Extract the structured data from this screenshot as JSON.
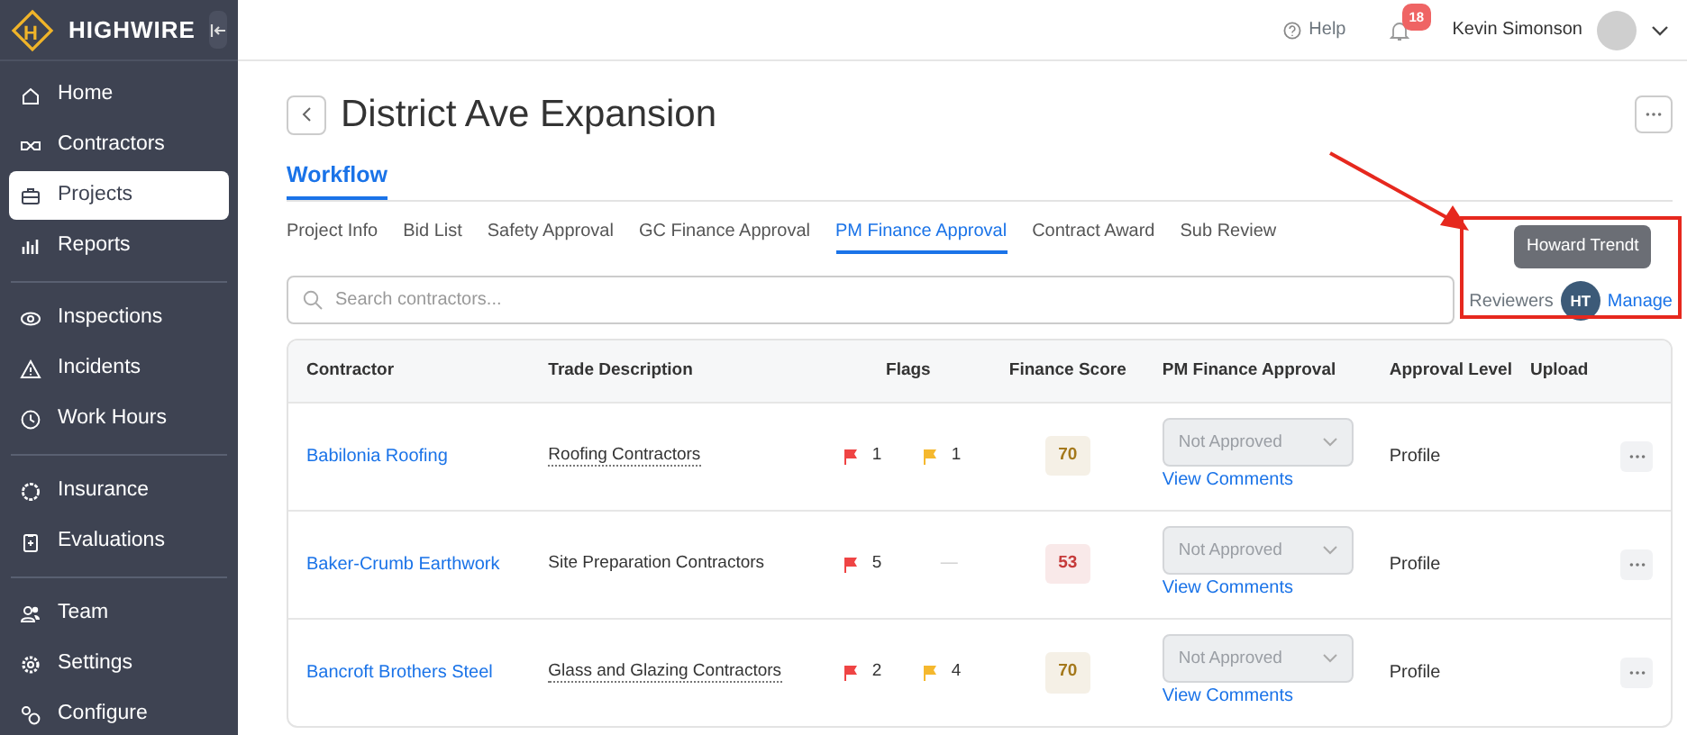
{
  "sidebar": {
    "logo_letter": "H",
    "brand": "HIGHWIRE",
    "groups": [
      [
        {
          "label": "Home",
          "selected": false
        },
        {
          "label": "Contractors",
          "selected": false
        },
        {
          "label": "Projects",
          "selected": true
        },
        {
          "label": "Reports",
          "selected": false
        }
      ],
      [
        {
          "label": "Inspections",
          "selected": false
        },
        {
          "label": "Incidents",
          "selected": false
        },
        {
          "label": "Work Hours",
          "selected": false
        }
      ],
      [
        {
          "label": "Insurance",
          "selected": false
        },
        {
          "label": "Evaluations",
          "selected": false
        }
      ],
      [
        {
          "label": "Team",
          "selected": false
        },
        {
          "label": "Settings",
          "selected": false
        },
        {
          "label": "Configure",
          "selected": false
        }
      ]
    ]
  },
  "topbar": {
    "help": "Help",
    "notifications": "18",
    "user": "Kevin Simonson"
  },
  "page": {
    "title": "District Ave Expansion",
    "section_tab": "Workflow",
    "tabs": [
      {
        "label": "Project Info",
        "selected": false
      },
      {
        "label": "Bid List",
        "selected": false
      },
      {
        "label": "Safety Approval",
        "selected": false
      },
      {
        "label": "GC Finance Approval",
        "selected": false
      },
      {
        "label": "PM Finance Approval",
        "selected": true
      },
      {
        "label": "Contract Award",
        "selected": false
      },
      {
        "label": "Sub Review",
        "selected": false
      }
    ],
    "search": {
      "placeholder": "Search contractors..."
    },
    "reviewers": {
      "label": "Reviewers",
      "initials": "HT",
      "tooltip": "Howard Trendt",
      "manage": "Manage"
    }
  },
  "table": {
    "columns": [
      "Contractor",
      "Trade Description",
      "Flags",
      "Finance Score",
      "PM Finance Approval",
      "Approval Level",
      "Upload"
    ],
    "rows": [
      {
        "contractor": "Babilonia Roofing",
        "trade": "Roofing Contractors",
        "dotted": true,
        "flags": [
          {
            "kind": "flag",
            "color": "#ef4444",
            "count": "1"
          },
          {
            "kind": "flag",
            "color": "#f5b82e",
            "count": "1"
          }
        ],
        "score": "70",
        "color": "#a4781b",
        "approval": "Not Approved",
        "comments": "View Comments",
        "level": "Profile"
      },
      {
        "contractor": "Baker-Crumb Earthwork",
        "trade": "Site Preparation Contractors",
        "dotted": false,
        "flags": [
          {
            "kind": "flag",
            "color": "#ef4444",
            "count": "5"
          },
          {
            "kind": "empty",
            "count": "—"
          }
        ],
        "score": "53",
        "color": "#c63b3b",
        "approval": "Not Approved",
        "comments": "View Comments",
        "level": "Profile"
      },
      {
        "contractor": "Bancroft Brothers Steel",
        "trade": "Glass and Glazing Contractors",
        "dotted": true,
        "flags": [
          {
            "kind": "flag",
            "color": "#ef4444",
            "count": "2"
          },
          {
            "kind": "flag",
            "color": "#f5b82e",
            "count": "4"
          }
        ],
        "score": "70",
        "color": "#a4781b",
        "approval": "Not Approved",
        "comments": "View Comments",
        "level": "Profile"
      }
    ]
  }
}
